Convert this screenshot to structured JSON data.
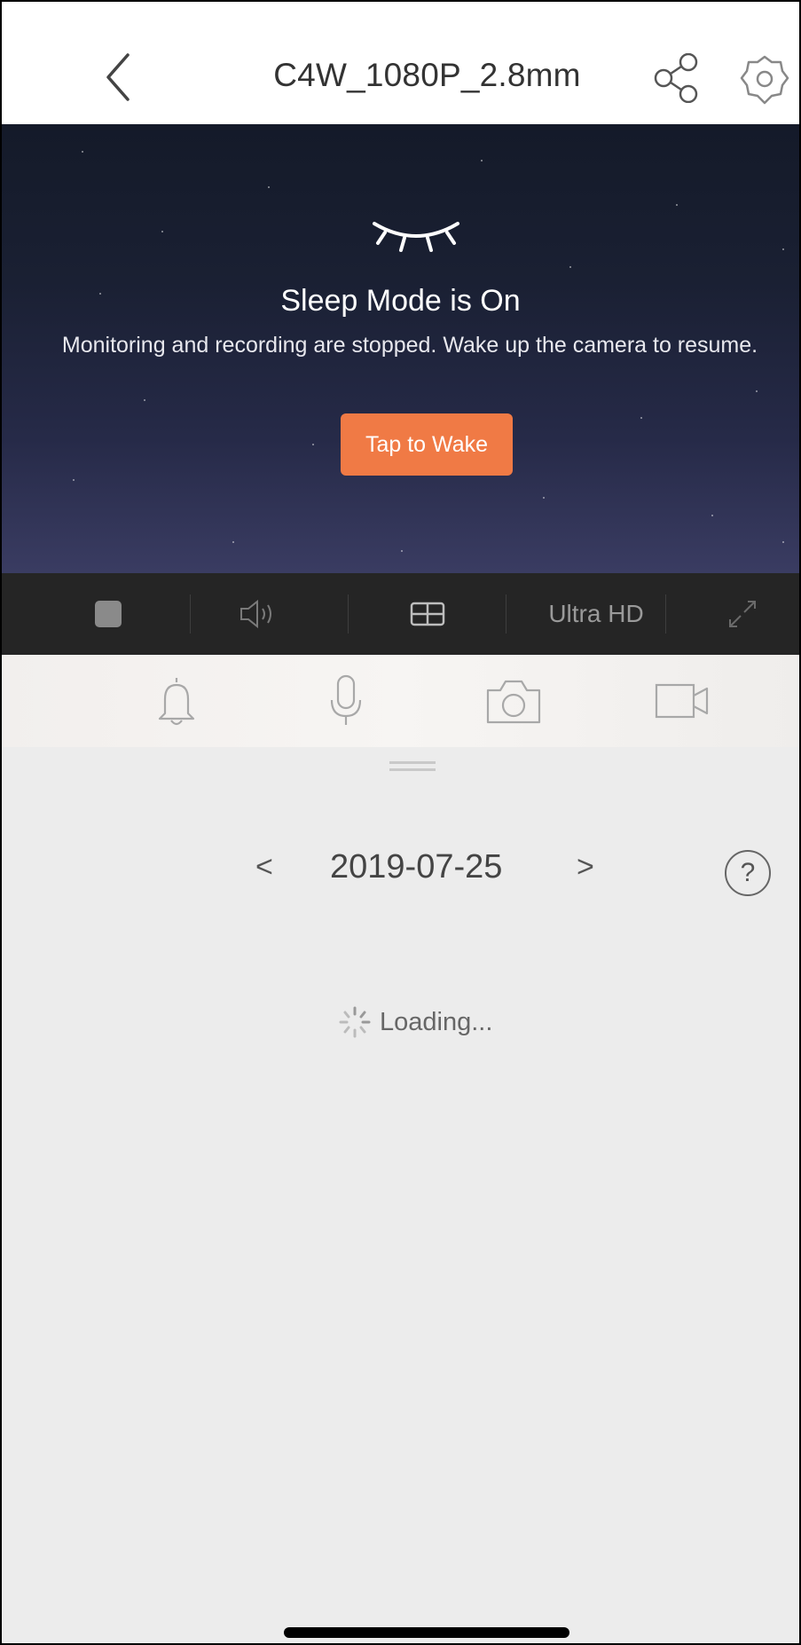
{
  "header": {
    "title": "C4W_1080P_2.8mm",
    "back_icon": "chevron-left-icon",
    "share_icon": "share-icon",
    "settings_icon": "gear-icon"
  },
  "video": {
    "sleep_icon": "closed-eye-icon",
    "sleep_title": "Sleep Mode is On",
    "sleep_desc": "Monitoring and recording are stopped. Wake up the camera to resume.",
    "wake_button": "Tap to Wake",
    "wake_color": "#f07a45"
  },
  "controls": {
    "stop_icon": "stop-icon",
    "sound_icon": "speaker-icon",
    "layout_icon": "grid-layout-icon",
    "quality": "Ultra HD",
    "fullscreen_icon": "fullscreen-icon"
  },
  "actions": {
    "alarm_icon": "bell-icon",
    "talk_icon": "microphone-icon",
    "snapshot_icon": "camera-icon",
    "record_icon": "video-record-icon"
  },
  "playback": {
    "prev": "<",
    "date": "2019-07-25",
    "next": ">",
    "help": "?",
    "loading": "Loading..."
  }
}
